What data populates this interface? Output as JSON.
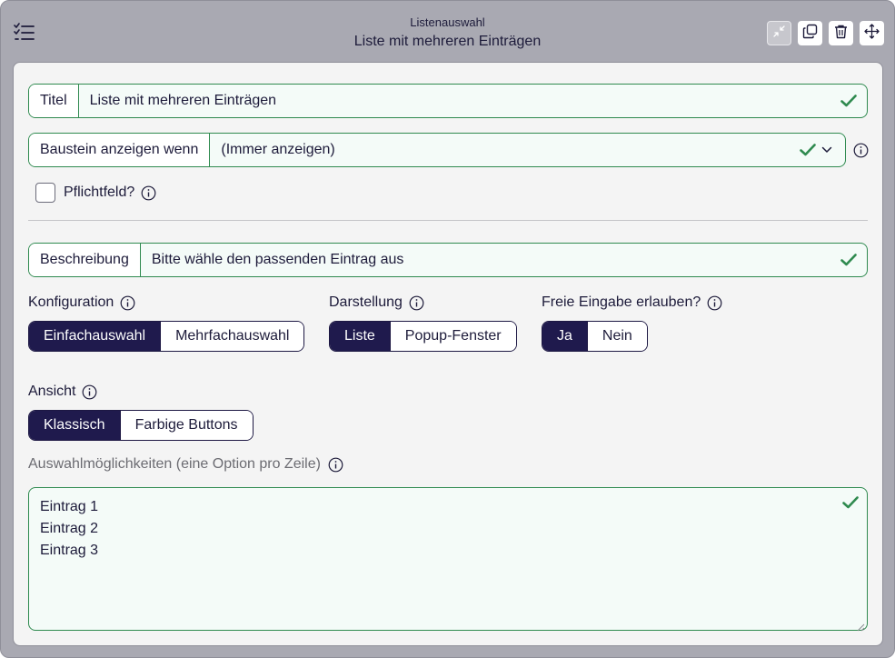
{
  "header": {
    "subtitle": "Listenauswahl",
    "title": "Liste mit mehreren Einträgen"
  },
  "toolbar": {
    "buttons": [
      "collapse-icon",
      "duplicate-icon",
      "trash-icon",
      "move-icon"
    ]
  },
  "form": {
    "title_field": {
      "label": "Titel",
      "value": "Liste mit mehreren Einträgen"
    },
    "show_when_field": {
      "label": "Baustein anzeigen wenn",
      "value": "(Immer anzeigen)"
    },
    "required_label": "Pflichtfeld?",
    "required_checked": false,
    "description_field": {
      "label": "Beschreibung",
      "value": "Bitte wähle den passenden Eintrag aus"
    },
    "konfiguration": {
      "label": "Konfiguration",
      "options": [
        "Einfachauswahl",
        "Mehrfachauswahl"
      ],
      "selected": "Einfachauswahl"
    },
    "darstellung": {
      "label": "Darstellung",
      "options": [
        "Liste",
        "Popup-Fenster"
      ],
      "selected": "Liste"
    },
    "freie_eingabe": {
      "label": "Freie Eingabe erlauben?",
      "options": [
        "Ja",
        "Nein"
      ],
      "selected": "Ja"
    },
    "ansicht": {
      "label": "Ansicht",
      "options": [
        "Klassisch",
        "Farbige Buttons"
      ],
      "selected": "Klassisch"
    },
    "options_label": "Auswahlmöglichkeiten (eine Option pro Zeile)",
    "options_entries": [
      "Eintrag 1",
      "Eintrag 2",
      "Eintrag 3"
    ]
  },
  "colors": {
    "accent_dark": "#1f1a4d",
    "valid_green": "#2f8a4f",
    "frame_gray": "#a9a9b2",
    "card_bg": "#f4f4f4"
  }
}
